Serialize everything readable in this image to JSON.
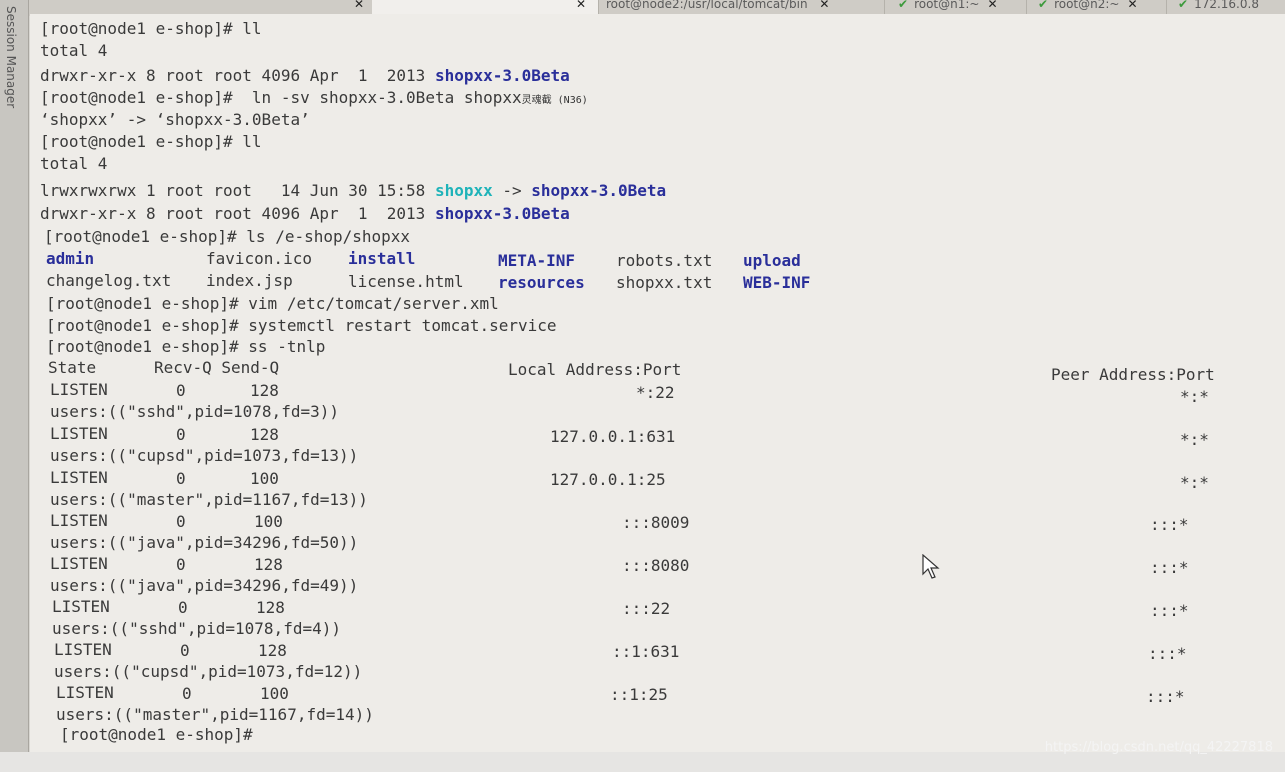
{
  "tabs": [
    {
      "label": "",
      "active": false
    },
    {
      "label": "",
      "active": true
    },
    {
      "label": "root@node2:/usr/local/tomcat/bin",
      "active": false
    },
    {
      "label": "root@n1:~",
      "active": false
    },
    {
      "label": "root@n2:~",
      "active": false
    },
    {
      "label": "172.16.0.8",
      "active": false
    }
  ],
  "side_label": "Session Manager",
  "terminal": {
    "l1": "[root@node1 e-shop]# ll",
    "l2": "total 4",
    "l3_perm": "drwxr-xr-x 8 root root 4096 Apr  1  2013 ",
    "l3_name": "shopxx-3.0Beta",
    "l4_cmd": "[root@node1 e-shop]#  ln -sv shopxx-3.0Beta shopxx",
    "l4_note": "灵魂截 (N36)",
    "l5": "‘shopxx’ -> ‘shopxx-3.0Beta’",
    "l6": "[root@node1 e-shop]# ll",
    "l7": "total 4",
    "l8_perm": "lrwxrwxrwx 1 root root   14 Jun 30 15:58 ",
    "l8_link": "shopxx",
    "l8_arrow": " -> ",
    "l8_target": "shopxx-3.0Beta",
    "l9_perm": "drwxr-xr-x 8 root root 4096 Apr  1  2013 ",
    "l9_name": "shopxx-3.0Beta",
    "l10": "[root@node1 e-shop]# ls /e-shop/shopxx",
    "ls_row1": [
      {
        "t": "admin",
        "dir": true
      },
      {
        "t": "favicon.ico",
        "dir": false
      },
      {
        "t": "install",
        "dir": true
      },
      {
        "t": "META-INF",
        "dir": true
      },
      {
        "t": "robots.txt",
        "dir": false
      },
      {
        "t": "upload",
        "dir": true
      }
    ],
    "ls_row2": [
      {
        "t": "changelog.txt",
        "dir": false
      },
      {
        "t": "index.jsp",
        "dir": false
      },
      {
        "t": "license.html",
        "dir": false
      },
      {
        "t": "resources",
        "dir": true
      },
      {
        "t": "shopxx.txt",
        "dir": false
      },
      {
        "t": "WEB-INF",
        "dir": true
      }
    ],
    "l13": "[root@node1 e-shop]# vim /etc/tomcat/server.xml",
    "l14": "[root@node1 e-shop]# systemctl restart tomcat.service",
    "l15": "[root@node1 e-shop]# ss -tnlp",
    "hdr_left": "State      Recv-Q Send-Q",
    "hdr_local": "Local Address:Port",
    "hdr_peer": "Peer Address:Port",
    "ss_rows": [
      {
        "state": "LISTEN",
        "recv": "0",
        "send": "128",
        "local": "*:22",
        "peer": "*:*",
        "users": "users:((\"sshd\",pid=1078,fd=3))"
      },
      {
        "state": "LISTEN",
        "recv": "0",
        "send": "128",
        "local": "127.0.0.1:631",
        "peer": "*:*",
        "users": "users:((\"cupsd\",pid=1073,fd=13))"
      },
      {
        "state": "LISTEN",
        "recv": "0",
        "send": "100",
        "local": "127.0.0.1:25",
        "peer": "*:*",
        "users": "users:((\"master\",pid=1167,fd=13))"
      },
      {
        "state": "LISTEN",
        "recv": "0",
        "send": "100",
        "local": ":::8009",
        "peer": ":::*",
        "users": "users:((\"java\",pid=34296,fd=50))"
      },
      {
        "state": "LISTEN",
        "recv": "0",
        "send": "128",
        "local": ":::8080",
        "peer": ":::*",
        "users": "users:((\"java\",pid=34296,fd=49))"
      },
      {
        "state": "LISTEN",
        "recv": "0",
        "send": "128",
        "local": ":::22",
        "peer": ":::*",
        "users": "users:((\"sshd\",pid=1078,fd=4))"
      },
      {
        "state": "LISTEN",
        "recv": "0",
        "send": "128",
        "local": "::1:631",
        "peer": ":::*",
        "users": "users:((\"cupsd\",pid=1073,fd=12))"
      },
      {
        "state": "LISTEN",
        "recv": "0",
        "send": "100",
        "local": "::1:25",
        "peer": ":::*",
        "users": "users:((\"master\",pid=1167,fd=14))"
      }
    ],
    "last_prompt": "[root@node1 e-shop]#"
  },
  "watermark": "https://blog.csdn.net/qq_42227818",
  "colors": {
    "dir": "#2a2f9a",
    "symlink": "#1fb3b9",
    "text": "#3a3a3a",
    "bg": "#eeece8"
  },
  "icons": [
    "check-icon",
    "close-icon",
    "mouse-pointer-icon"
  ]
}
